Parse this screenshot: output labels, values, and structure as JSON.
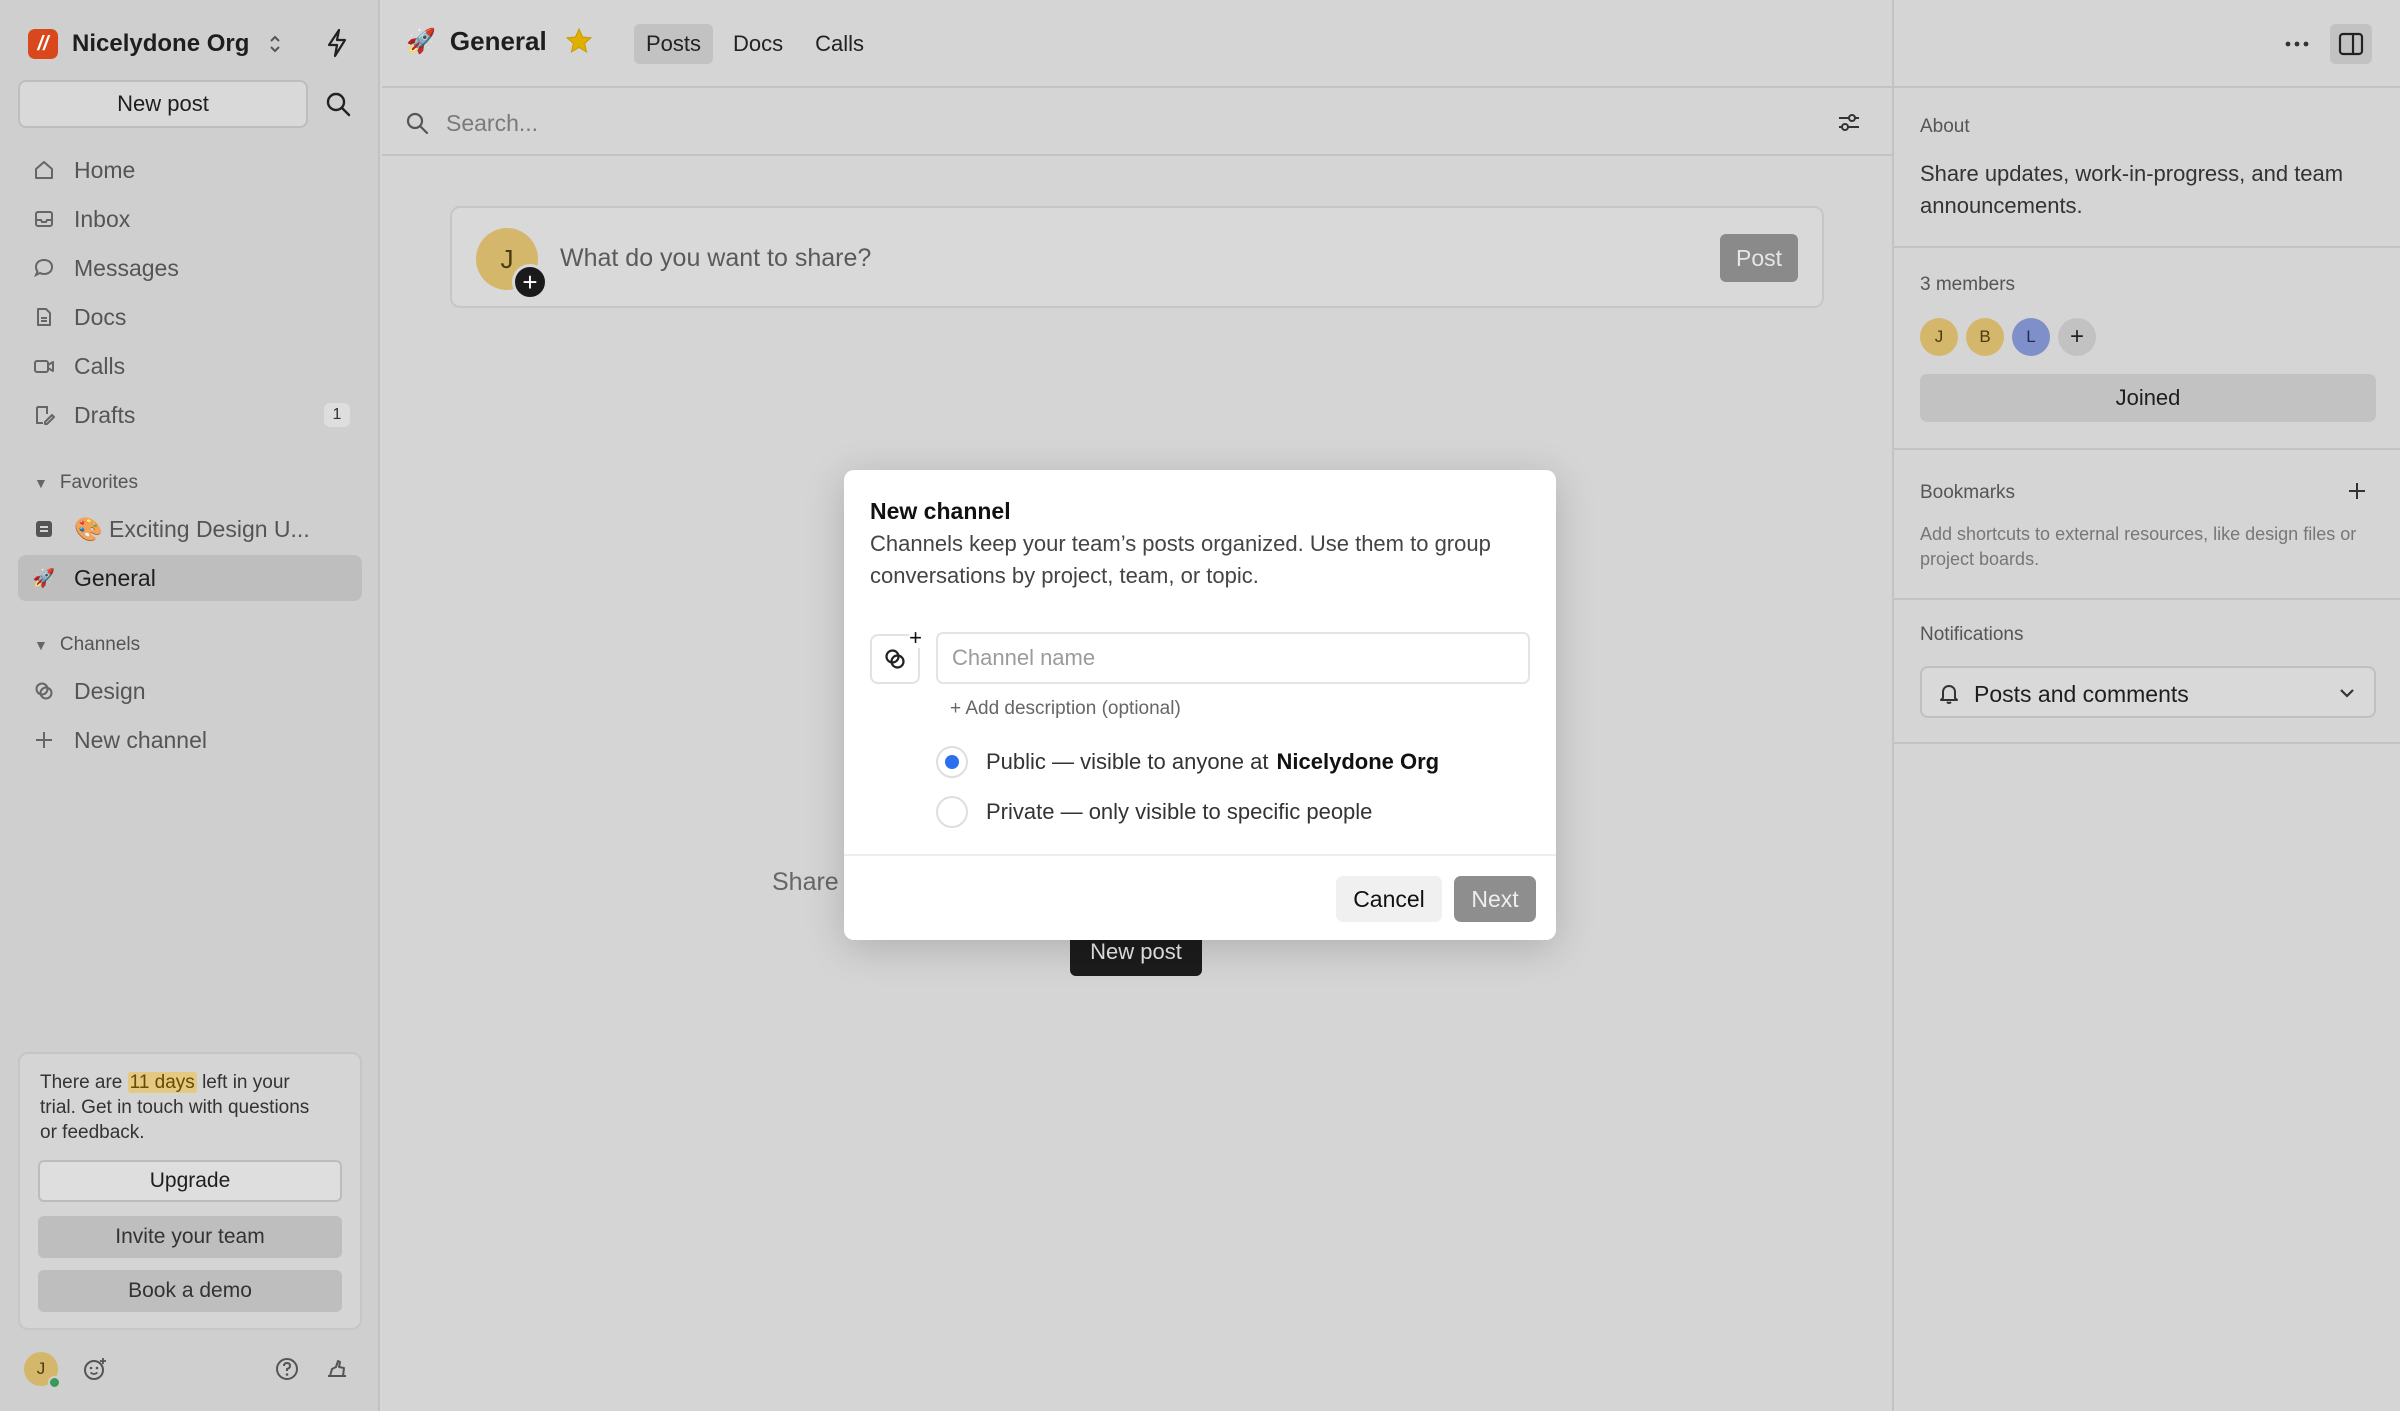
{
  "sidebar": {
    "org_name": "Nicelydone Org",
    "new_post": "New post",
    "nav": [
      {
        "label": "Home",
        "icon": "home-icon"
      },
      {
        "label": "Inbox",
        "icon": "inbox-icon"
      },
      {
        "label": "Messages",
        "icon": "chat-bubble-icon"
      },
      {
        "label": "Docs",
        "icon": "doc-icon"
      },
      {
        "label": "Calls",
        "icon": "video-icon"
      },
      {
        "label": "Drafts",
        "icon": "draft-icon",
        "badge": "1"
      }
    ],
    "favorites_header": "Favorites",
    "favorites": [
      {
        "label": "🎨 Exciting Design U..."
      },
      {
        "label": "General",
        "emoji": "🚀"
      }
    ],
    "channels_header": "Channels",
    "channels": [
      {
        "label": "Design"
      },
      {
        "label": "New channel"
      }
    ],
    "trial": {
      "text_before": "There are ",
      "highlight": "11 days",
      "text_after": " left in your trial. Get in touch with questions or feedback.",
      "upgrade": "Upgrade",
      "invite": "Invite your team",
      "demo": "Book a demo"
    },
    "user_initial": "J"
  },
  "main": {
    "channel_emoji": "🚀",
    "channel_title": "General",
    "tabs": [
      "Posts",
      "Docs",
      "Calls"
    ],
    "active_tab": "Posts",
    "search_placeholder": "Search...",
    "composer": {
      "avatar_initial": "J",
      "prompt": "What do you want to share?",
      "post": "Post"
    },
    "empty_share": "Share",
    "empty_new_post": "New post"
  },
  "right": {
    "about_header": "About",
    "about_text": "Share updates, work-in-progress, and team announcements.",
    "members_header": "3 members",
    "members": [
      {
        "initial": "J",
        "color": "#d4b76b"
      },
      {
        "initial": "B",
        "color": "#d4b76b"
      },
      {
        "initial": "L",
        "color": "#7f8fc9"
      }
    ],
    "joined": "Joined",
    "bookmarks_header": "Bookmarks",
    "bookmarks_text": "Add shortcuts to external resources, like design files or project boards.",
    "notifications_header": "Notifications",
    "notifications_value": "Posts and comments"
  },
  "modal": {
    "title": "New channel",
    "description": "Channels keep your team’s posts organized. Use them to group conversations by project, team, or topic.",
    "name_placeholder": "Channel name",
    "add_description": "+ Add description (optional)",
    "public_label": "Public — visible to anyone at",
    "public_org": "Nicelydone Org",
    "private_label": "Private — only visible to specific people",
    "cancel": "Cancel",
    "next": "Next"
  },
  "colors": {
    "accent_blue": "#2b6ff0",
    "logo_orange": "#d9471c",
    "star_gold": "#e0b000"
  }
}
